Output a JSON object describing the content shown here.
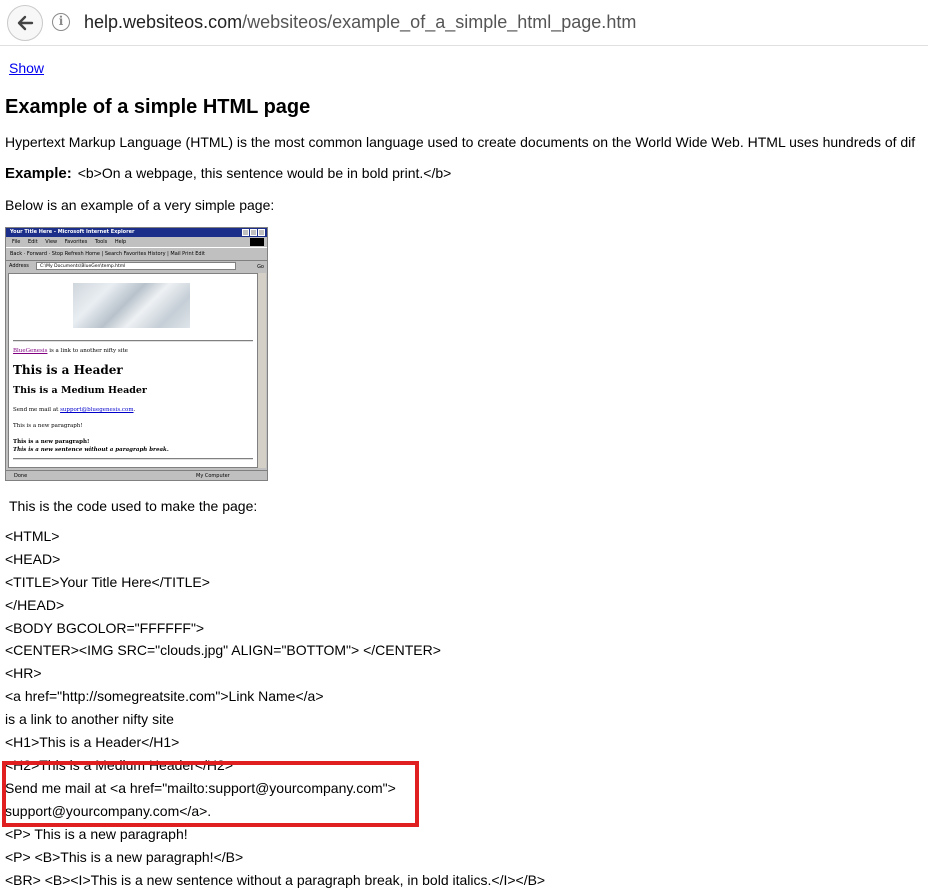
{
  "browser": {
    "url_host": "help.websiteos.com",
    "url_path": "/websiteos/example_of_a_simple_html_page.htm",
    "info_glyph": "i"
  },
  "page": {
    "show_link": "Show",
    "title": "Example of a simple HTML page",
    "intro": "Hypertext Markup Language (HTML) is the most common language used to create documents on the World Wide Web. HTML uses hundreds of dif",
    "example_label": "Example:",
    "example_text": "<b>On a webpage, this sentence would be in bold print.</b>",
    "below_text": "Below is an example of a very simple page:",
    "code_intro": "This is the code used to make the page:"
  },
  "thumbnail": {
    "window_title": "Your Title Here - Microsoft Internet Explorer",
    "menu": [
      "File",
      "Edit",
      "View",
      "Favorites",
      "Tools",
      "Help"
    ],
    "toolbar": "Back  ·  Forward  ·  Stop  Refresh  Home  |  Search  Favorites  History  |  Mail  Print  Edit",
    "address_label": "Address",
    "address_value": "C:\\My Documents\\BlueGen\\temp.html",
    "go_label": "Go",
    "link_text": "BlueGenesis",
    "link_suffix": " is a link to another nifty site",
    "header": "This is a Header",
    "medium_header": "This is a Medium Header",
    "mail_prefix": "Send me mail at ",
    "mail_link": "support@bluegenesis.com",
    "mail_suffix": ".",
    "paragraph": "This is a new paragraph!",
    "bold_paragraph": "This is a new paragraph!",
    "bold_italic": "This is a new sentence without a paragraph break.",
    "status_left": "Done",
    "status_right": "My Computer"
  },
  "code_lines": [
    "<HTML>",
    "<HEAD>",
    "<TITLE>Your Title Here</TITLE>",
    "</HEAD>",
    "<BODY BGCOLOR=\"FFFFFF\">",
    "<CENTER><IMG SRC=\"clouds.jpg\" ALIGN=\"BOTTOM\"> </CENTER>",
    "<HR>",
    "<a href=\"http://somegreatsite.com\">Link Name</a>",
    "is a link to another nifty site",
    "<H1>This is a Header</H1>",
    "<H2>This is a Medium Header</H2>",
    "Send me mail at <a href=\"mailto:support@yourcompany.com\">",
    "support@yourcompany.com</a>.",
    "<P> This is a new paragraph!",
    "<P> <B>This is a new paragraph!</B>",
    "<BR> <B><I>This is a new sentence without a paragraph break, in bold italics.</I></B>"
  ],
  "colors": {
    "link": "#0000ee",
    "highlight_border": "#e02020"
  }
}
